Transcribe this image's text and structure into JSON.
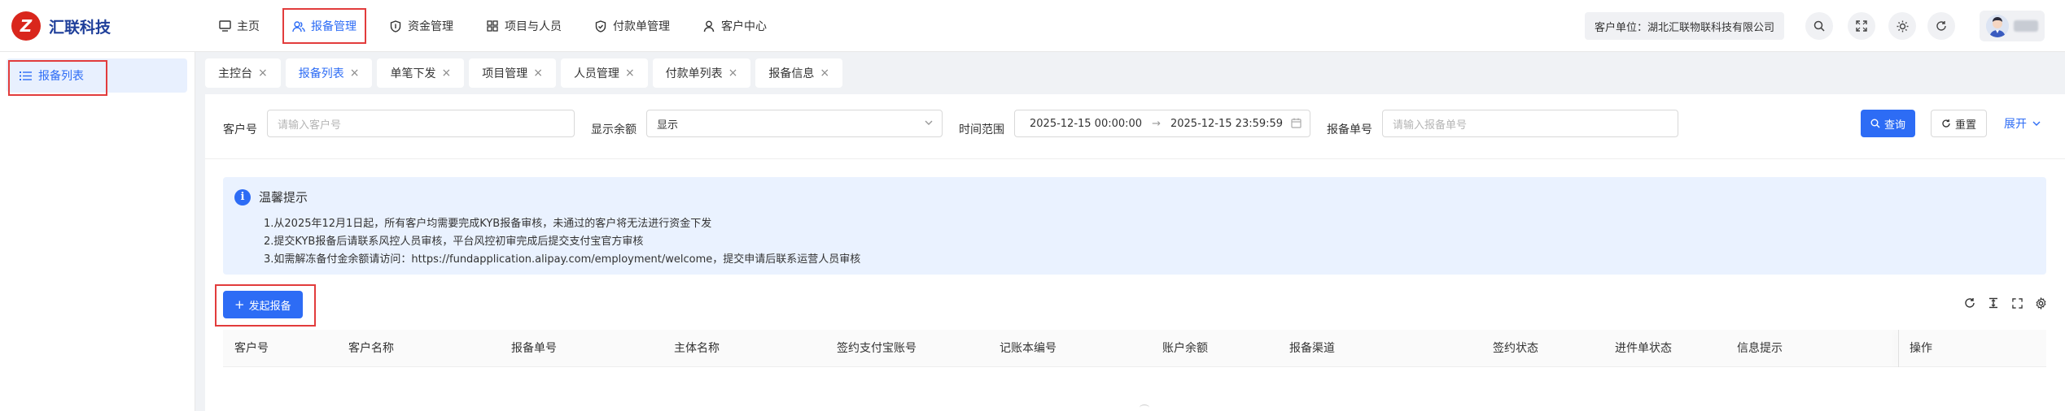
{
  "brand": {
    "logo_letter": "Z",
    "name": "汇联科技"
  },
  "nav": [
    {
      "label": "主页"
    },
    {
      "label": "报备管理"
    },
    {
      "label": "资金管理"
    },
    {
      "label": "项目与人员"
    },
    {
      "label": "付款单管理"
    },
    {
      "label": "客户中心"
    }
  ],
  "header": {
    "customer_unit": "客户单位：湖北汇联物联科技有限公司"
  },
  "sidebar": {
    "items": [
      {
        "label": "报备列表"
      }
    ]
  },
  "tabs": [
    {
      "label": "主控台"
    },
    {
      "label": "报备列表"
    },
    {
      "label": "单笔下发"
    },
    {
      "label": "项目管理"
    },
    {
      "label": "人员管理"
    },
    {
      "label": "付款单列表"
    },
    {
      "label": "报备信息"
    }
  ],
  "filters": {
    "customer_no_label": "客户号",
    "customer_no_placeholder": "请输入客户号",
    "show_balance_label": "显示余额",
    "show_balance_value": "显示",
    "time_range_label": "时间范围",
    "time_start": "2025-12-15 00:00:00",
    "time_end": "2025-12-15 23:59:59",
    "report_no_label": "报备单号",
    "report_no_placeholder": "请输入报备单号",
    "query_label": "查询",
    "reset_label": "重置",
    "expand_label": "展开"
  },
  "notice": {
    "title": "温馨提示",
    "lines": [
      "1.从2025年12月1日起，所有客户均需要完成KYB报备审核，未通过的客户将无法进行资金下发",
      "2.提交KYB报备后请联系风控人员审核，平台风控初审完成后提交支付宝官方审核",
      "3.如需解冻备付金余额请访问：https://fundapplication.alipay.com/employment/welcome，提交申请后联系运营人员审核"
    ]
  },
  "actions": {
    "create_label": "发起报备"
  },
  "table": {
    "columns": [
      "客户号",
      "客户名称",
      "报备单号",
      "主体名称",
      "签约支付宝账号",
      "记账本编号",
      "账户余额",
      "报备渠道",
      "签约状态",
      "进件单状态",
      "信息提示",
      "操作"
    ]
  },
  "colors": {
    "primary": "#2d6cf5",
    "highlight": "#e23c3c",
    "brand_red": "#d9261c",
    "brand_blue": "#1f3f9a"
  }
}
